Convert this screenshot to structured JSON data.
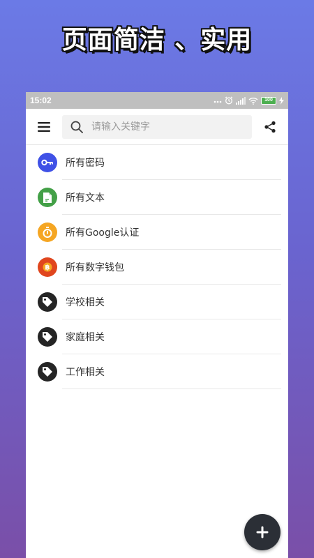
{
  "headline": "页面简洁 、实用",
  "status": {
    "time": "15:02",
    "battery": "100"
  },
  "search": {
    "placeholder": "请输入关键字"
  },
  "colors": {
    "blue": "#3f51e6",
    "green": "#43a047",
    "amber": "#f5a623",
    "orange_red": "#e0461e",
    "dark": "#252525"
  },
  "items": [
    {
      "label": "所有密码",
      "icon": "key-icon"
    },
    {
      "label": "所有文本",
      "icon": "document-icon"
    },
    {
      "label": "所有Google认证",
      "icon": "stopwatch-icon"
    },
    {
      "label": "所有数字钱包",
      "icon": "bitcoin-icon"
    },
    {
      "label": "学校相关",
      "icon": "tag-icon"
    },
    {
      "label": "家庭相关",
      "icon": "tag-icon"
    },
    {
      "label": "工作相关",
      "icon": "tag-icon"
    }
  ]
}
